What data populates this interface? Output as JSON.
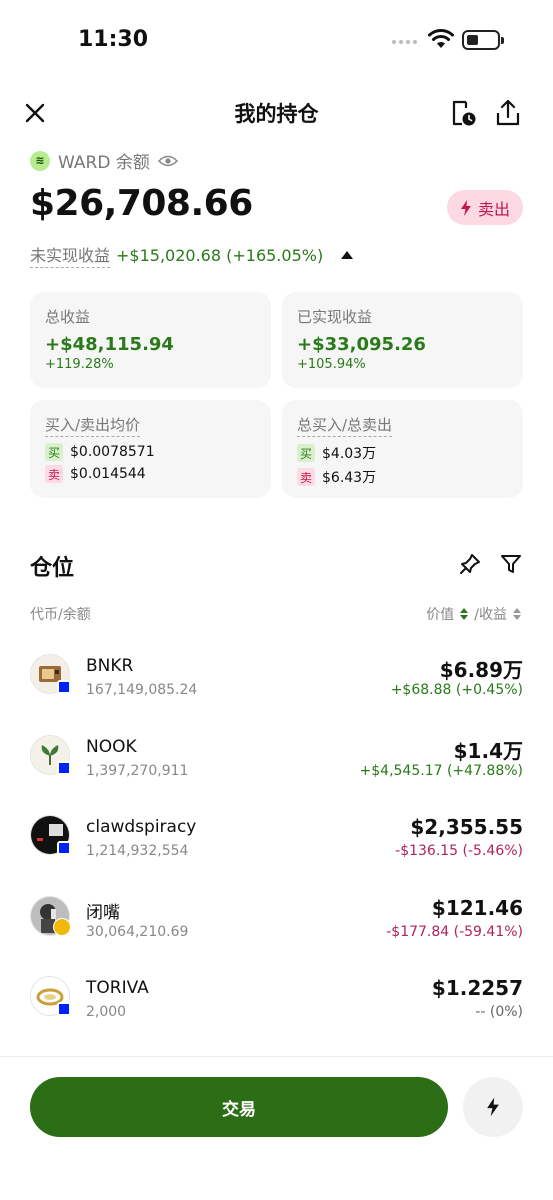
{
  "status": {
    "time": "11:30"
  },
  "header": {
    "title": "我的持仓"
  },
  "balance": {
    "label": "WARD 余额",
    "value": "$26,708.66",
    "sell_label": "卖出",
    "unrealized_label": "未实现收益",
    "unrealized_value": "+$15,020.68 (+165.05%)"
  },
  "cards": {
    "total_pnl": {
      "label": "总收益",
      "value": "+$48,115.94",
      "sub": "+119.28%"
    },
    "realized_pnl": {
      "label": "已实现收益",
      "value": "+$33,095.26",
      "sub": "+105.94%"
    },
    "avg_price": {
      "label": "买入/卖出均价",
      "buy_tag": "买",
      "buy_value": "$0.0078571",
      "sell_tag": "卖",
      "sell_value": "$0.014544"
    },
    "total_trade": {
      "label": "总买入/总卖出",
      "buy_tag": "买",
      "buy_value": "$4.03万",
      "sell_tag": "卖",
      "sell_value": "$6.43万"
    }
  },
  "positions": {
    "title": "仓位",
    "col_left": "代币/余额",
    "col_value": "价值",
    "col_pnl": "/收益",
    "items": [
      {
        "name": "BNKR",
        "amount": "167,149,085.24",
        "value": "$6.89万",
        "pnl": "+$68.88 (+0.45%)",
        "pnl_type": "pos"
      },
      {
        "name": "NOOK",
        "amount": "1,397,270,911",
        "value": "$1.4万",
        "pnl": "+$4,545.17 (+47.88%)",
        "pnl_type": "pos"
      },
      {
        "name": "clawdspiracy",
        "amount": "1,214,932,554",
        "value": "$2,355.55",
        "pnl": "-$136.15 (-5.46%)",
        "pnl_type": "neg"
      },
      {
        "name": "闭嘴",
        "amount": "30,064,210.69",
        "value": "$121.46",
        "pnl": "-$177.84 (-59.41%)",
        "pnl_type": "neg"
      },
      {
        "name": "TORIVA",
        "amount": "2,000",
        "value": "$1.2257",
        "pnl": "-- (0%)",
        "pnl_type": "zero"
      }
    ]
  },
  "bottom": {
    "trade_label": "交易"
  },
  "colors": {
    "accent_green": "#2c6e16",
    "positive": "#2a7a1a",
    "negative": "#b0245a",
    "sell_bg": "#fcd9e3"
  }
}
